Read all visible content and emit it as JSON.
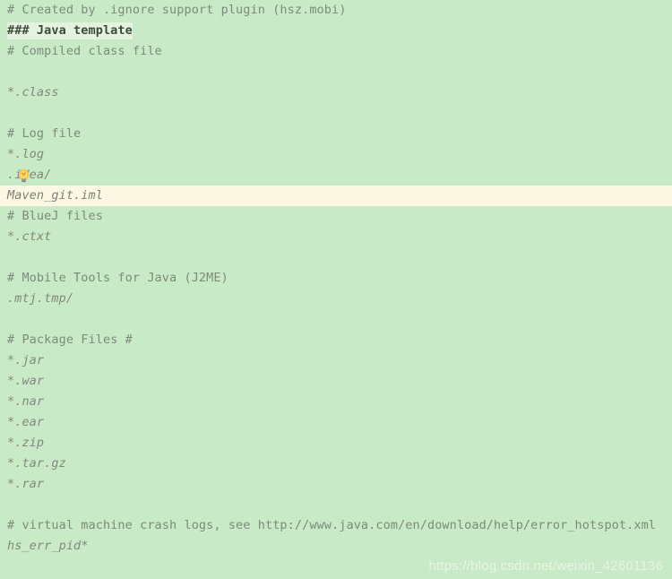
{
  "editor": {
    "background_color": "#c9eac6",
    "comment_color": "#7d8a7d",
    "pattern_color": "#82877f",
    "current_line_color": "#fdf8e3",
    "selection_color": "#e4f3e0",
    "header_color": "#3c4a3c"
  },
  "icons": {
    "intention_bulb": "lightbulb-icon"
  },
  "lines": [
    {
      "id": "l1",
      "kind": "comment",
      "text": "# Created by .ignore support plugin (hsz.mobi)"
    },
    {
      "id": "l2",
      "kind": "section-header",
      "text": "### Java template"
    },
    {
      "id": "l3",
      "kind": "comment",
      "text": "# Compiled class file"
    },
    {
      "id": "l4",
      "kind": "blank",
      "text": ""
    },
    {
      "id": "l5",
      "kind": "pattern",
      "text": "*.class"
    },
    {
      "id": "l6",
      "kind": "blank",
      "text": ""
    },
    {
      "id": "l7",
      "kind": "comment",
      "text": "# Log file"
    },
    {
      "id": "l8",
      "kind": "pattern",
      "text": "*.log"
    },
    {
      "id": "l9",
      "kind": "pattern",
      "text": ".idea/"
    },
    {
      "id": "l10",
      "kind": "current-line",
      "text": "Maven_git.iml"
    },
    {
      "id": "l11",
      "kind": "comment",
      "text": "# BlueJ files"
    },
    {
      "id": "l12",
      "kind": "pattern",
      "text": "*.ctxt"
    },
    {
      "id": "l13",
      "kind": "blank",
      "text": ""
    },
    {
      "id": "l14",
      "kind": "comment",
      "text": "# Mobile Tools for Java (J2ME)"
    },
    {
      "id": "l15",
      "kind": "pattern",
      "text": ".mtj.tmp/"
    },
    {
      "id": "l16",
      "kind": "blank",
      "text": ""
    },
    {
      "id": "l17",
      "kind": "comment",
      "text": "# Package Files #"
    },
    {
      "id": "l18",
      "kind": "pattern",
      "text": "*.jar"
    },
    {
      "id": "l19",
      "kind": "pattern",
      "text": "*.war"
    },
    {
      "id": "l20",
      "kind": "pattern",
      "text": "*.nar"
    },
    {
      "id": "l21",
      "kind": "pattern",
      "text": "*.ear"
    },
    {
      "id": "l22",
      "kind": "pattern",
      "text": "*.zip"
    },
    {
      "id": "l23",
      "kind": "pattern",
      "text": "*.tar.gz"
    },
    {
      "id": "l24",
      "kind": "pattern",
      "text": "*.rar"
    },
    {
      "id": "l25",
      "kind": "blank",
      "text": ""
    },
    {
      "id": "l26",
      "kind": "comment",
      "text": "# virtual machine crash logs, see http://www.java.com/en/download/help/error_hotspot.xml"
    },
    {
      "id": "l27",
      "kind": "pattern",
      "text": "hs_err_pid*"
    }
  ],
  "watermark": {
    "text": "https://blog.csdn.net/weixin_42601136"
  }
}
